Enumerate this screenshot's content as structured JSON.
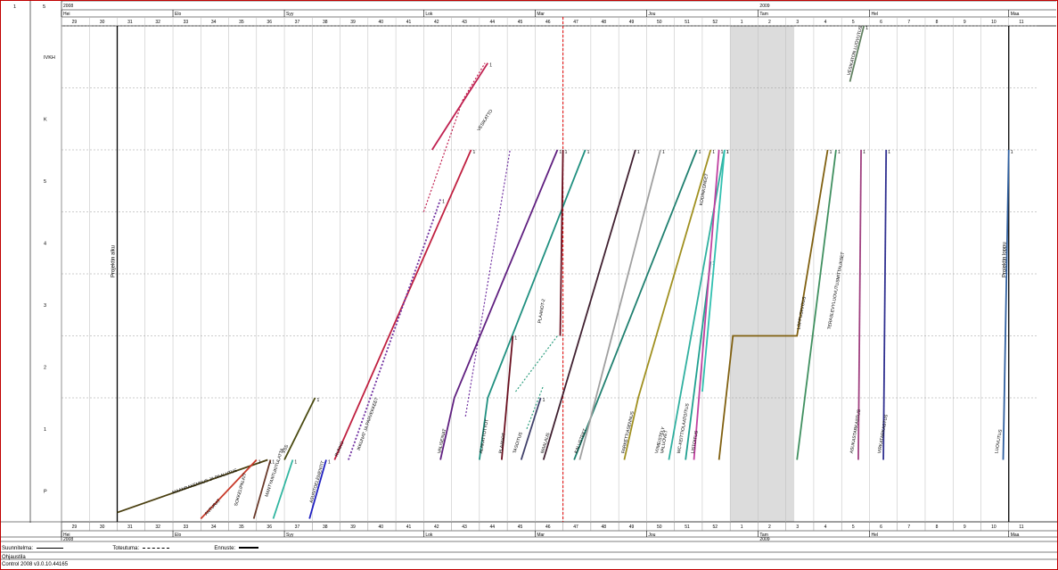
{
  "header": {
    "left_a": "1",
    "left_b": "5"
  },
  "years": [
    {
      "label": "2008",
      "week": 28
    },
    {
      "label": "2009",
      "week": 53
    }
  ],
  "months": [
    {
      "label": "Hei",
      "week": 28
    },
    {
      "label": "Elo",
      "week": 32
    },
    {
      "label": "Syy",
      "week": 36
    },
    {
      "label": "Lok",
      "week": 41
    },
    {
      "label": "Mar",
      "week": 45
    },
    {
      "label": "Jou",
      "week": 49
    },
    {
      "label": "Tam",
      "week": 53
    },
    {
      "label": "Hel",
      "week": 57
    },
    {
      "label": "Maa",
      "week": 62
    }
  ],
  "weeks": [
    "29",
    "30",
    "31",
    "32",
    "33",
    "34",
    "35",
    "36",
    "37",
    "38",
    "39",
    "40",
    "41",
    "42",
    "43",
    "44",
    "45",
    "46",
    "47",
    "48",
    "49",
    "50",
    "51",
    "52",
    "1",
    "2",
    "3",
    "4",
    "5",
    "6",
    "7",
    "8",
    "9",
    "10",
    "11"
  ],
  "floors": [
    "P",
    "1",
    "2",
    "3",
    "4",
    "5",
    "K",
    "IVKH"
  ],
  "legend": {
    "plan": "Suunnitelma:",
    "actual": "Toteutuma:",
    "forecast": "Ennuste:"
  },
  "footer": {
    "project": "Ohjaustila",
    "version": "Control 2008 v3.0.10.44165"
  },
  "colors": {
    "border": "#c00000",
    "now_line": "#e00000",
    "shade": "#dcdcdc"
  },
  "chart_data": {
    "type": "line",
    "x_unit": "week",
    "y_unit": "floor",
    "xlim": [
      28,
      63
    ],
    "ylim": [
      -1,
      7
    ],
    "y_categories": [
      "P",
      "1",
      "2",
      "3",
      "4",
      "5",
      "K",
      "IVKH"
    ],
    "now_week": 46.0,
    "shaded_weeks": [
      52,
      54.3
    ],
    "milestones": [
      {
        "label": "Projektin alku",
        "week": 30.0
      },
      {
        "label": "Projektin loppu",
        "week": 62.0
      }
    ],
    "series": [
      {
        "name": "MAANRAKENNUS JA PAALUTUS",
        "color": "#4a3f10",
        "points": [
          [
            30.0,
            -0.85
          ],
          [
            35.4,
            0
          ]
        ],
        "label_week": 32.0,
        "label_floor": -0.55
      },
      {
        "name": "ANTURAT",
        "color": "#c83a2a",
        "points": [
          [
            33.0,
            -0.95
          ],
          [
            35.0,
            0
          ]
        ],
        "label_week": 33.2,
        "label_floor": -0.9
      },
      {
        "name": "SOKKELIPALKIT",
        "color": "#6a3a2a",
        "points": [
          [
            34.9,
            -0.95
          ],
          [
            35.5,
            0
          ]
        ],
        "label_week": 34.3,
        "label_floor": -0.75
      },
      {
        "name": "MANTYANTUKITULATTA",
        "color": "#30b5a0",
        "points": [
          [
            35.6,
            -0.95
          ],
          [
            36.3,
            0
          ]
        ],
        "label_week": 35.4,
        "label_floor": -0.6
      },
      {
        "name": "VSS",
        "color": "#4a4a10",
        "points": [
          [
            36.0,
            0
          ],
          [
            37.1,
            1
          ]
        ],
        "label_week": 36.0,
        "label_floor": 0.1
      },
      {
        "name": "ASUNTOELEMENTIT",
        "color": "#2020c0",
        "points": [
          [
            36.9,
            -0.95
          ],
          [
            37.5,
            0
          ]
        ],
        "label_week": 37.0,
        "label_floor": -0.7
      },
      {
        "name": "RUNKO",
        "color": "#c02040",
        "points": [
          [
            37.8,
            0
          ],
          [
            42.7,
            5
          ]
        ],
        "label_week": 37.9,
        "label_floor": 0.05
      },
      {
        "name": "IKKUNAT JA PARVEKKEET",
        "color": "#7030a0",
        "points": [
          [
            38.3,
            0
          ],
          [
            41.6,
            4.2
          ]
        ],
        "dashed": true,
        "label_week": 38.7,
        "label_floor": 0.15
      },
      {
        "name": "VESIKATTO",
        "color": "#c02050",
        "points": [
          [
            41.3,
            5
          ],
          [
            43.3,
            6.4
          ]
        ],
        "label_week": 43.0,
        "label_floor": 5.3
      },
      {
        "name": "VALISEINAT",
        "color": "#602080",
        "points": [
          [
            41.6,
            0
          ],
          [
            42.1,
            1
          ],
          [
            45.8,
            5
          ]
        ],
        "label_week": 41.6,
        "label_floor": 0.1
      },
      {
        "name": "ALAKATTOTYOT",
        "color": "#209080",
        "points": [
          [
            43.0,
            0
          ],
          [
            43.3,
            1
          ],
          [
            46.8,
            5
          ]
        ],
        "label_week": 43.1,
        "label_floor": 0.1
      },
      {
        "name": "PLAANOT",
        "color": "#6a1020",
        "points": [
          [
            43.8,
            0
          ],
          [
            44.2,
            2
          ]
        ],
        "label_week": 43.8,
        "label_floor": 0.1
      },
      {
        "name": "PLAANOT-2",
        "color": "#6a1020",
        "points": [
          [
            45.9,
            2
          ],
          [
            46.0,
            5
          ]
        ],
        "label_week": 45.2,
        "label_floor": 2.2
      },
      {
        "name": "TASOITUS",
        "color": "#40406a",
        "points": [
          [
            44.5,
            0
          ],
          [
            45.2,
            1
          ]
        ],
        "label_week": 44.3,
        "label_floor": 0.1
      },
      {
        "name": "MAALAUS",
        "color": "#402030",
        "points": [
          [
            45.3,
            0
          ],
          [
            48.6,
            5
          ]
        ],
        "label_week": 45.3,
        "label_floor": 0.1
      },
      {
        "name": "KALUSTEET",
        "color": "#208070",
        "points": [
          [
            46.4,
            0
          ],
          [
            50.8,
            5
          ]
        ],
        "label_week": 46.5,
        "label_floor": 0.1
      },
      {
        "name": "PARKETTIASENNUS",
        "color": "#a09020",
        "points": [
          [
            48.2,
            0
          ],
          [
            48.7,
            1
          ],
          [
            51.3,
            5
          ]
        ],
        "label_week": 48.2,
        "label_floor": 0.1
      },
      {
        "name": "VIIMEISTELY",
        "color": "#a0a0a0",
        "points": [
          [
            46.6,
            0
          ],
          [
            49.5,
            5
          ]
        ],
        "label_week": 49.4,
        "label_floor": 0.1
      },
      {
        "name": "VALUOVET",
        "color": "#30b0a0",
        "points": [
          [
            49.8,
            0
          ],
          [
            51.8,
            5
          ]
        ],
        "label_week": 49.6,
        "label_floor": 0.1
      },
      {
        "name": "WC-KEITTIOLAATOITUS",
        "color": "#20a090",
        "points": [
          [
            50.4,
            0
          ],
          [
            51.3,
            3.2
          ]
        ],
        "label_week": 50.2,
        "label_floor": 0.1
      },
      {
        "name": "LISTOITUS",
        "color": "#c040a0",
        "points": [
          [
            50.7,
            0
          ],
          [
            51.6,
            5
          ]
        ],
        "label_week": 50.7,
        "label_floor": 0.1
      },
      {
        "name": "KODINKONEET",
        "color": "#30c0b0",
        "points": [
          [
            51.0,
            1.1
          ],
          [
            51.8,
            5
          ]
        ],
        "label_week": 51.0,
        "label_floor": 4.1
      },
      {
        "name": "LOPPUSIIVOUS",
        "color": "#806010",
        "points": [
          [
            51.6,
            0
          ],
          [
            52.1,
            2
          ],
          [
            54.4,
            2
          ],
          [
            55.5,
            5
          ]
        ],
        "label_week": 54.5,
        "label_floor": 2.1
      },
      {
        "name": "TERASLEVYLUOVUTUSMITTAUKSET",
        "color": "#409060",
        "points": [
          [
            54.4,
            0
          ],
          [
            55.8,
            5
          ]
        ],
        "label_week": 55.6,
        "label_floor": 2.1
      },
      {
        "name": "VESIKATON LUOVUTUS",
        "color": "#608060",
        "points": [
          [
            56.3,
            6.1
          ],
          [
            56.8,
            7
          ]
        ],
        "label_week": 56.3,
        "label_floor": 6.2
      },
      {
        "name": "ASUKASTARKASTUS",
        "color": "#a04080",
        "points": [
          [
            56.6,
            0
          ],
          [
            56.7,
            5
          ]
        ],
        "label_week": 56.4,
        "label_floor": 0.1
      },
      {
        "name": "VIRKATARKASTUS",
        "color": "#303090",
        "points": [
          [
            57.5,
            0
          ],
          [
            57.6,
            5
          ]
        ],
        "label_week": 57.4,
        "label_floor": 0.1
      },
      {
        "name": "LUOVUTUS",
        "color": "#3060a0",
        "points": [
          [
            61.8,
            0
          ],
          [
            62.0,
            5
          ]
        ],
        "label_week": 61.6,
        "label_floor": 0.1
      }
    ],
    "dashed_series": [
      {
        "color": "#c02050",
        "points": [
          [
            41.0,
            4
          ],
          [
            42.4,
            5.8
          ],
          [
            43.2,
            6.4
          ]
        ]
      },
      {
        "color": "#7030a0",
        "points": [
          [
            42.5,
            0.7
          ],
          [
            44.1,
            5
          ]
        ]
      },
      {
        "color": "#30a080",
        "points": [
          [
            44.3,
            1.1
          ],
          [
            45.8,
            2
          ]
        ]
      },
      {
        "color": "#30a080",
        "points": [
          [
            44.7,
            0.5
          ],
          [
            45.3,
            1.2
          ]
        ]
      }
    ]
  }
}
